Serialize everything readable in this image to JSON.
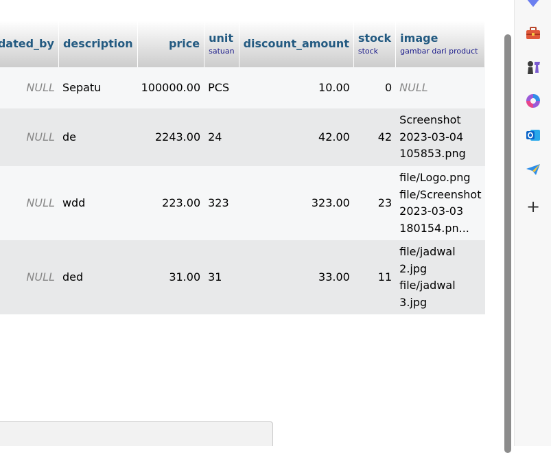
{
  "table": {
    "headers": [
      {
        "title": "updated_by",
        "comment": ""
      },
      {
        "title": "description",
        "comment": ""
      },
      {
        "title": "price",
        "comment": ""
      },
      {
        "title": "unit",
        "comment": "satuan"
      },
      {
        "title": "discount_amount",
        "comment": ""
      },
      {
        "title": "stock",
        "comment": "stock"
      },
      {
        "title": "image",
        "comment": "gambar dari product"
      }
    ],
    "rows": [
      {
        "updated_by": "NULL",
        "description": "Sepatu",
        "price": "100000.00",
        "unit": "PCS",
        "discount_amount": "10.00",
        "stock": "0",
        "image": [
          "NULL"
        ]
      },
      {
        "updated_by": "NULL",
        "description": "de",
        "price": "2243.00",
        "unit": "24",
        "discount_amount": "42.00",
        "stock": "42",
        "image": [
          "Screenshot",
          "2023-03-04",
          "105853.png"
        ]
      },
      {
        "updated_by": "NULL",
        "description": "wdd",
        "price": "223.00",
        "unit": "323",
        "discount_amount": "323.00",
        "stock": "23",
        "image": [
          "file/Logo.png",
          "file/Screenshot",
          "2023-03-03",
          "180154.pn..."
        ]
      },
      {
        "updated_by": "NULL",
        "description": "ded",
        "price": "31.00",
        "unit": "31",
        "discount_amount": "33.00",
        "stock": "11",
        "image": [
          "file/jadwal",
          "2.jpg",
          "file/jadwal",
          "3.jpg"
        ]
      }
    ]
  },
  "sidebar": {
    "icons": [
      "diamond-icon",
      "toolbox-icon",
      "chess-icon",
      "copilot-icon",
      "outlook-icon",
      "send-icon",
      "add-icon"
    ],
    "add_label": "+"
  },
  "colors": {
    "header_text": "#235a81",
    "odd_row": "#f6f7f8",
    "even_row": "#e8e9ea",
    "null_text": "#888888"
  }
}
